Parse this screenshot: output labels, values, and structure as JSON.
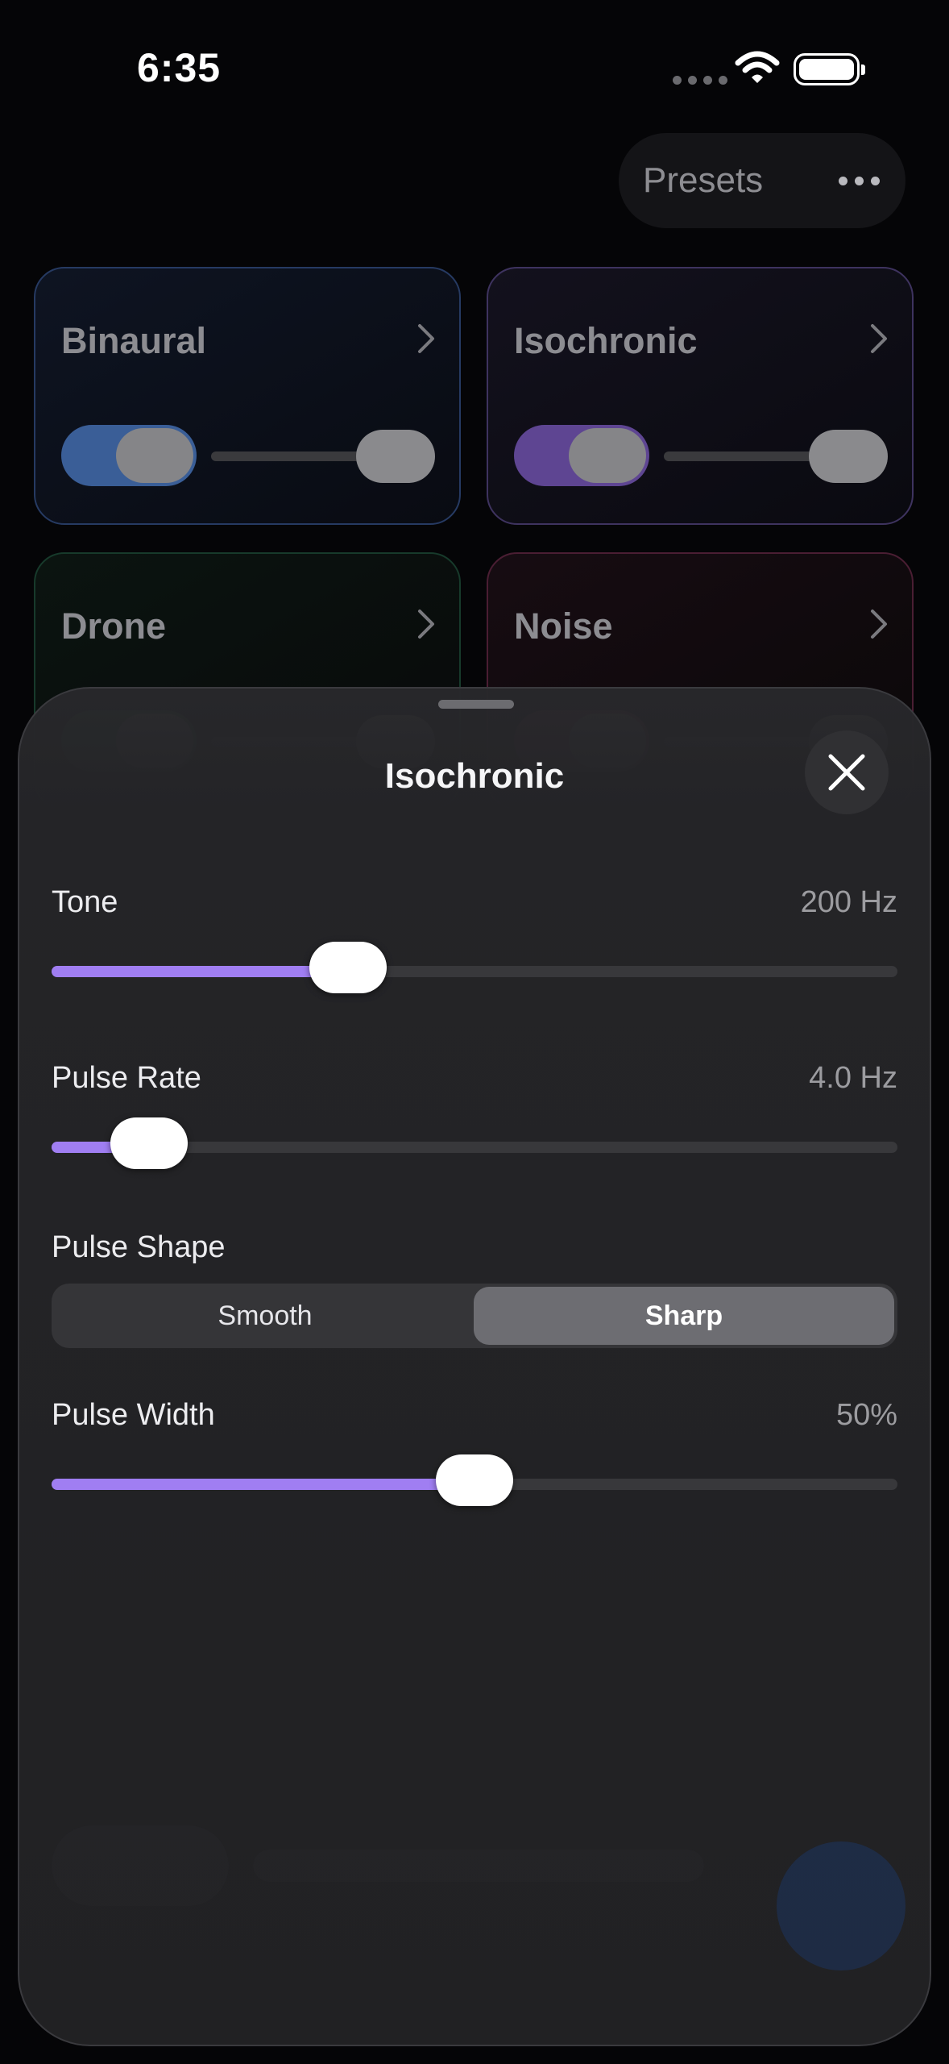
{
  "status_bar": {
    "time": "6:35"
  },
  "top_bar": {
    "presets_label": "Presets"
  },
  "cards": {
    "binaural": {
      "title": "Binaural"
    },
    "isochronic": {
      "title": "Isochronic"
    },
    "drone": {
      "title": "Drone"
    },
    "noise": {
      "title": "Noise"
    }
  },
  "sheet": {
    "title": "Isochronic",
    "tone": {
      "label": "Tone",
      "value": "200 Hz",
      "level": 0.35
    },
    "pulse_rate": {
      "label": "Pulse Rate",
      "value": "4.0 Hz",
      "level": 0.115
    },
    "pulse_shape": {
      "label": "Pulse Shape",
      "options": [
        "Smooth",
        "Sharp"
      ],
      "selected": "Sharp"
    },
    "pulse_width": {
      "label": "Pulse Width",
      "value": "50%",
      "level": 0.5
    }
  },
  "colors": {
    "accent": "#a07ef2",
    "background": "#050507",
    "sheet": "#242427"
  }
}
